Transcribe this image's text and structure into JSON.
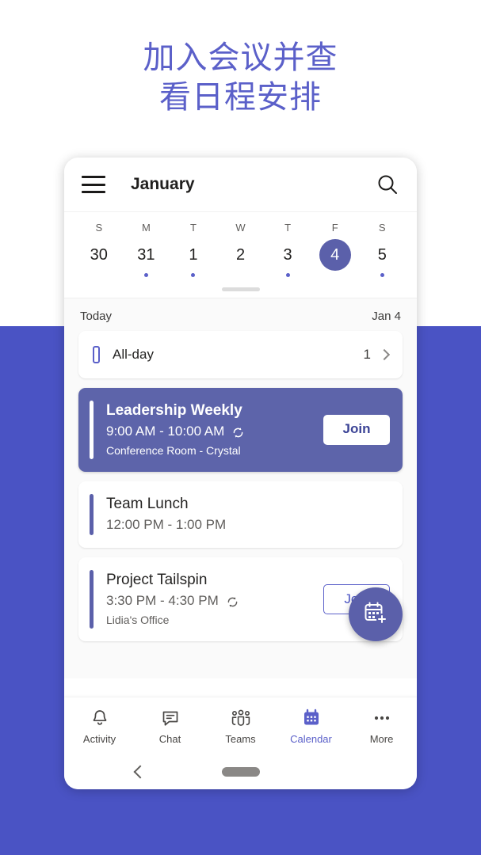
{
  "headline": {
    "line1": "加入会议并查",
    "line2": "看日程安排",
    "color": "#5b60c9"
  },
  "background": {
    "top_color": "#ffffff",
    "bottom_color": "#4a53c4"
  },
  "app": {
    "header": {
      "menu_icon": "hamburger-icon",
      "title": "January",
      "search_icon": "search-icon"
    },
    "calendar_strip": {
      "days": [
        {
          "dow": "S",
          "num": "30",
          "selected": false,
          "dot": false
        },
        {
          "dow": "M",
          "num": "31",
          "selected": false,
          "dot": true
        },
        {
          "dow": "T",
          "num": "1",
          "selected": false,
          "dot": true
        },
        {
          "dow": "W",
          "num": "2",
          "selected": false,
          "dot": false
        },
        {
          "dow": "T",
          "num": "3",
          "selected": false,
          "dot": true
        },
        {
          "dow": "F",
          "num": "4",
          "selected": true,
          "dot": false
        },
        {
          "dow": "S",
          "num": "5",
          "selected": false,
          "dot": true
        }
      ],
      "selected_color": "#5b60aa",
      "dot_color": "#5b60c9"
    },
    "agenda": {
      "today_label": "Today",
      "today_date": "Jan 4",
      "allday": {
        "label": "All-day",
        "count": "1",
        "icon": "allday-bar-icon",
        "chevron": "chevron-right-icon"
      },
      "events": [
        {
          "title": "Leadership Weekly",
          "time": "9:00 AM - 10:00 AM",
          "location": "Conference Room -  Crystal",
          "recurring": true,
          "join_label": "Join",
          "highlighted": true,
          "card_color": "#5d64aa"
        },
        {
          "title": "Team Lunch",
          "time": "12:00 PM - 1:00 PM",
          "location": "",
          "recurring": false,
          "join_label": "",
          "highlighted": false,
          "card_color": "#ffffff"
        },
        {
          "title": "Project Tailspin",
          "time": "3:30 PM - 4:30 PM",
          "location": "Lidia's Office",
          "recurring": true,
          "join_label": "Join",
          "highlighted": false,
          "card_color": "#ffffff"
        }
      ]
    },
    "fab": {
      "icon": "calendar-add-icon",
      "color": "#5b60aa"
    },
    "bottom_nav": {
      "items": [
        {
          "label": "Activity",
          "icon": "bell-icon",
          "active": false
        },
        {
          "label": "Chat",
          "icon": "chat-icon",
          "active": false
        },
        {
          "label": "Teams",
          "icon": "teams-icon",
          "active": false
        },
        {
          "label": "Calendar",
          "icon": "calendar-icon",
          "active": true
        },
        {
          "label": "More",
          "icon": "ellipsis-icon",
          "active": false
        }
      ],
      "active_color": "#5b60c9"
    },
    "system_nav": {
      "back_icon": "back-chevron-icon",
      "home_pill": "home-pill-icon"
    }
  }
}
